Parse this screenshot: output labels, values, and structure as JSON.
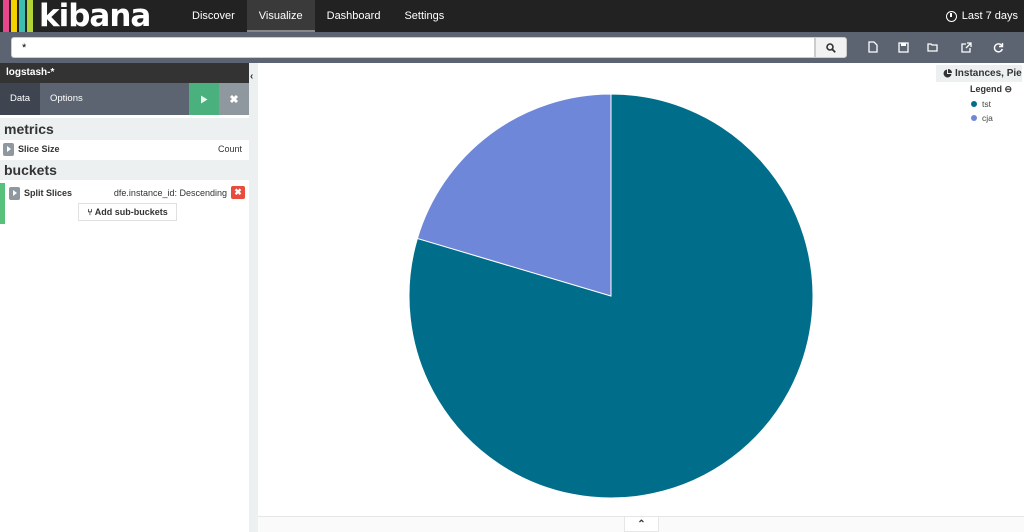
{
  "app": {
    "logo_text": "kibana",
    "logo_bar_colors": [
      "#e8488b",
      "#f5d000",
      "#3cbeb1",
      "#b2d235",
      "#6a7bc8"
    ]
  },
  "nav": {
    "tabs": [
      {
        "label": "Discover",
        "active": false
      },
      {
        "label": "Visualize",
        "active": true
      },
      {
        "label": "Dashboard",
        "active": false
      },
      {
        "label": "Settings",
        "active": false
      }
    ],
    "time_label": "Last 7 days"
  },
  "search": {
    "value": "*",
    "toolbar_icons": [
      "new-visualization-icon",
      "save-icon",
      "open-icon",
      "share-icon",
      "reload-icon"
    ]
  },
  "sidebar": {
    "index_pattern": "logstash-*",
    "tabs": [
      {
        "label": "Data",
        "active": true
      },
      {
        "label": "Options",
        "active": false
      }
    ],
    "metrics_heading": "metrics",
    "metric": {
      "label": "Slice Size",
      "value": "Count"
    },
    "buckets_heading": "buckets",
    "bucket": {
      "label": "Split Slices",
      "value": "dfe.instance_id: Descending"
    },
    "add_sub_buckets_label": "Add sub-buckets"
  },
  "visualization": {
    "title": "Instances, Pie",
    "legend_title": "Legend",
    "legend": [
      {
        "name": "tst",
        "color": "#006e8a"
      },
      {
        "name": "cja",
        "color": "#6f87d8"
      }
    ]
  },
  "chart_data": {
    "type": "pie",
    "categories": [
      "tst",
      "cja"
    ],
    "values": [
      79.6,
      20.4
    ],
    "colors": [
      "#006e8a",
      "#6f87d8"
    ],
    "legend_position": "top-right"
  }
}
